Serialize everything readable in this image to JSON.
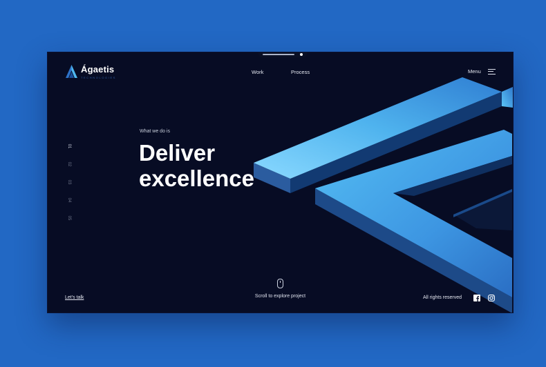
{
  "brand": {
    "name": "Ágaetis",
    "tagline": "TECHNOLOGIES"
  },
  "nav": {
    "items": [
      "Work",
      "Process"
    ],
    "menu_label": "Menu"
  },
  "pager": [
    "01",
    "02",
    "03",
    "04",
    "05"
  ],
  "hero": {
    "eyebrow": "What we do is",
    "line1": "Deliver",
    "line2": "excellence"
  },
  "footer": {
    "lets_talk": "Let's talk",
    "scroll_hint": "Scroll to explore project",
    "rights": "All rights reserved"
  },
  "colors": {
    "page_background": "#2268c4",
    "screen_background": "#070c24",
    "accent_light": "#7fd4ff",
    "accent_mid": "#3a8fe0",
    "accent_dark": "#1a4f98"
  },
  "icons": [
    "logo-mark-icon",
    "hamburger-icon",
    "mouse-icon",
    "facebook-icon",
    "instagram-icon"
  ]
}
